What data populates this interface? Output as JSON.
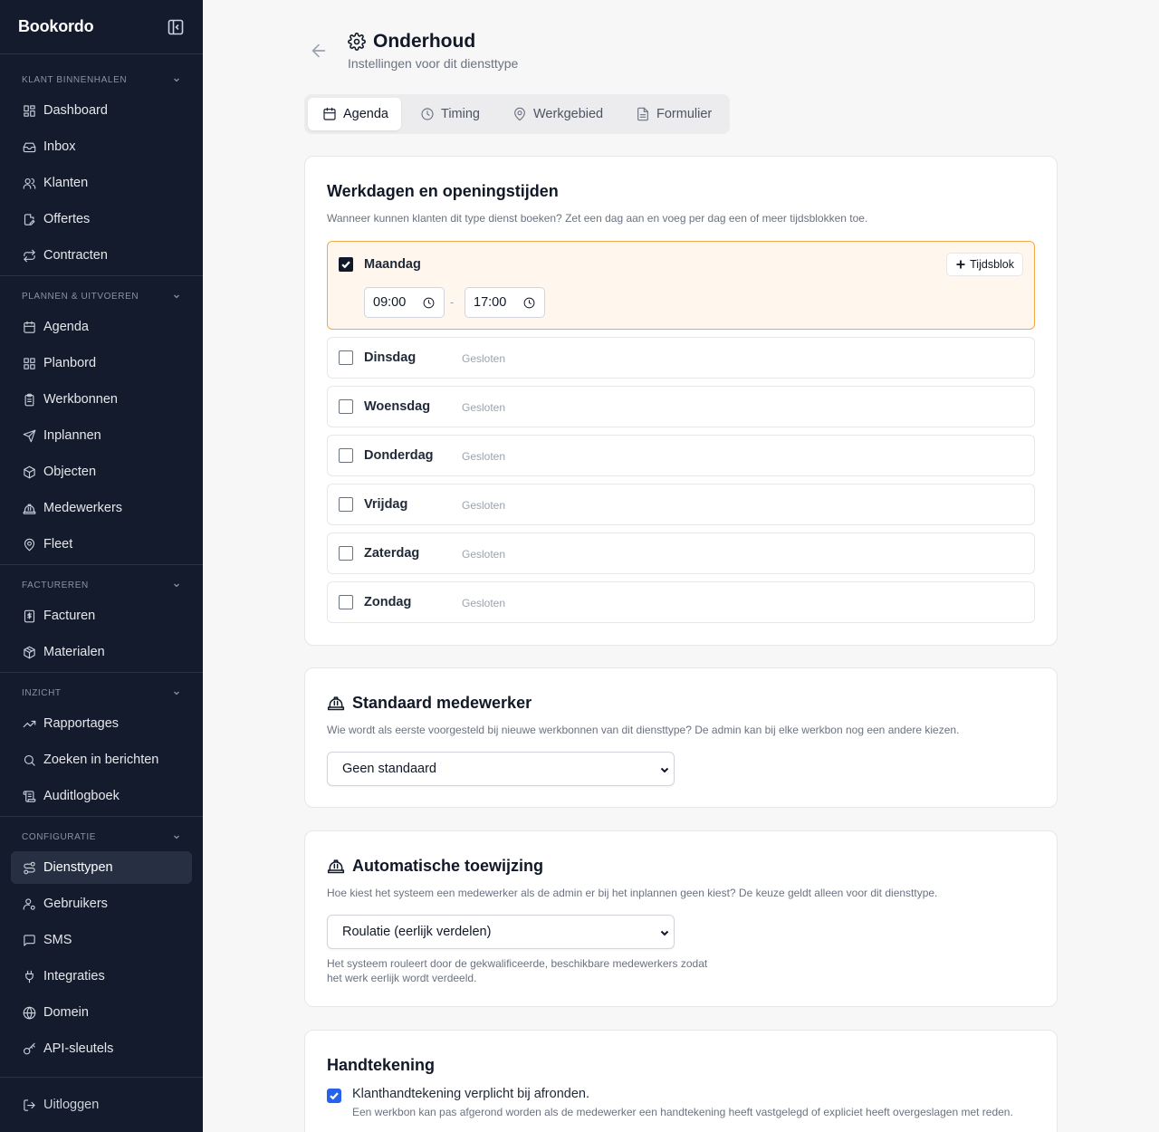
{
  "app": {
    "brand": "Bookordo"
  },
  "sidebar": {
    "sections": [
      {
        "title": "KLANT BINNENHALEN",
        "items": [
          "Dashboard",
          "Inbox",
          "Klanten",
          "Offertes",
          "Contracten"
        ]
      },
      {
        "title": "PLANNEN & UITVOEREN",
        "items": [
          "Agenda",
          "Planbord",
          "Werkbonnen",
          "Inplannen",
          "Objecten",
          "Medewerkers",
          "Fleet"
        ]
      },
      {
        "title": "FACTUREREN",
        "items": [
          "Facturen",
          "Materialen"
        ]
      },
      {
        "title": "INZICHT",
        "items": [
          "Rapportages",
          "Zoeken in berichten",
          "Auditlogboek"
        ]
      },
      {
        "title": "CONFIGURATIE",
        "items": [
          "Diensttypen",
          "Gebruikers",
          "SMS",
          "Integraties",
          "Domein",
          "API-sleutels"
        ]
      }
    ],
    "active": "Diensttypen",
    "logout": "Uitloggen"
  },
  "header": {
    "title": "Onderhoud",
    "subtitle": "Instellingen voor dit diensttype"
  },
  "tabs": [
    {
      "label": "Agenda",
      "icon": "calendar-icon",
      "active": true
    },
    {
      "label": "Timing",
      "icon": "clock-icon",
      "active": false
    },
    {
      "label": "Werkgebied",
      "icon": "map-pin-icon",
      "active": false
    },
    {
      "label": "Formulier",
      "icon": "file-icon",
      "active": false
    }
  ],
  "workdays": {
    "title": "Werkdagen en openingstijden",
    "description": "Wanneer kunnen klanten dit type dienst boeken? Zet een dag aan en voeg per dag een of meer tijdsblokken toe.",
    "add_block": "Tijdsblok",
    "closed_label": "Gesloten",
    "days": [
      {
        "name": "Maandag",
        "enabled": true,
        "start": "09:00",
        "end": "17:00"
      },
      {
        "name": "Dinsdag",
        "enabled": false
      },
      {
        "name": "Woensdag",
        "enabled": false
      },
      {
        "name": "Donderdag",
        "enabled": false
      },
      {
        "name": "Vrijdag",
        "enabled": false
      },
      {
        "name": "Zaterdag",
        "enabled": false
      },
      {
        "name": "Zondag",
        "enabled": false
      }
    ],
    "separator": "-"
  },
  "default_employee": {
    "title": "Standaard medewerker",
    "description": "Wie wordt als eerste voorgesteld bij nieuwe werkbonnen van dit diensttype? De admin kan bij elke werkbon nog een andere kiezen.",
    "selected": "Geen standaard"
  },
  "auto_assign": {
    "title": "Automatische toewijzing",
    "description": "Hoe kiest het systeem een medewerker als de admin er bij het inplannen geen kiest? De keuze geldt alleen voor dit diensttype.",
    "selected": "Roulatie (eerlijk verdelen)",
    "hint_line1": "Het systeem rouleert door de gekwalificeerde, beschikbare medewerkers zodat",
    "hint_line2": "het werk eerlijk wordt verdeeld."
  },
  "signature": {
    "title": "Handtekening",
    "checkbox_label": "Klanthandtekening verplicht bij afronden.",
    "checked": true,
    "hint": "Een werkbon kan pas afgerond worden als de medewerker een handtekening heeft vastgelegd of expliciet heeft overgeslagen met reden."
  },
  "colors": {
    "sidebar_bg": "#141b2c",
    "accent_orange": "#f4a949",
    "checkbox_blue": "#2563eb"
  }
}
